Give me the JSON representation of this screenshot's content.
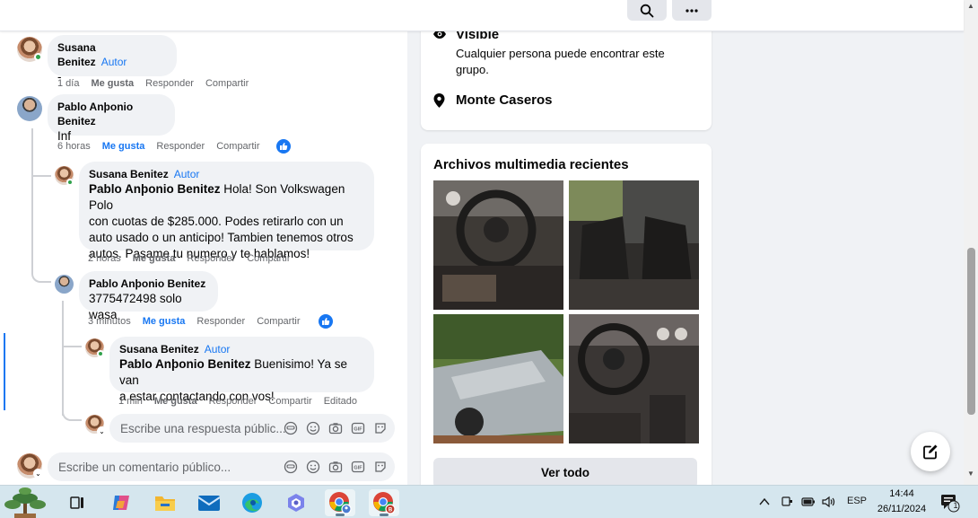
{
  "topbar": {
    "search_icon": "search-icon",
    "more_icon": "more-icon"
  },
  "comments": [
    {
      "author": "Susana Benitez",
      "badge": "Autor",
      "text": "-",
      "time": "1 día",
      "like": "Me gusta",
      "reply": "Responder",
      "share": "Compartir"
    },
    {
      "author": "Pablo Anþonio Benitez",
      "text": "Inf",
      "time": "6 horas",
      "like": "Me gusta",
      "reply": "Responder",
      "share": "Compartir"
    },
    {
      "author": "Susana Benitez",
      "badge": "Autor",
      "mention": "Pablo Anþonio Benitez",
      "text_l1": " Hola! Son Volkswagen Polo",
      "text_l2": "con cuotas de $285.000. Podes retirarlo con un",
      "text_l3": "auto usado o un anticipo! Tambien tenemos otros",
      "text_l4": "autos. Pasame tu numero y te hablamos!",
      "time": "2 horas",
      "like": "Me gusta",
      "reply": "Responder",
      "share": "Compartir"
    },
    {
      "author": "Pablo Anþonio Benitez",
      "text": "3775472498 solo wasa",
      "time": "3 minutos",
      "like": "Me gusta",
      "reply": "Responder",
      "share": "Compartir"
    },
    {
      "author": "Susana Benitez",
      "badge": "Autor",
      "mention": "Pablo Anþonio Benitez",
      "text_l1": " Buenisimo! Ya se van",
      "text_l2": "a estar contactando con vos!",
      "time": "1 min",
      "like": "Me gusta",
      "reply": "Responder",
      "share": "Compartir",
      "edited": "Editado"
    }
  ],
  "reply_input": {
    "placeholder": "Escribe una respuesta públic..."
  },
  "comment_input": {
    "placeholder": "Escribe un comentario público..."
  },
  "about": {
    "visible_title": "Visible",
    "visible_desc_l1": "Cualquier persona puede encontrar este",
    "visible_desc_l2": "grupo.",
    "location": "Monte Caseros"
  },
  "media": {
    "title": "Archivos multimedia recientes",
    "see_all": "Ver todo"
  },
  "taskbar": {
    "apps": [
      "widgets-icon",
      "start-icon",
      "task-view-icon",
      "copilot-icon",
      "file-explorer-icon",
      "mail-icon",
      "edge-icon",
      "teams-icon",
      "chrome-profile-icon",
      "chrome-icon"
    ],
    "lang": "ESP",
    "time": "14:44",
    "date": "26/11/2024",
    "notifications": "1"
  },
  "colors": {
    "accent": "#1877f2",
    "bubble": "#f0f2f5",
    "muted": "#65676b",
    "online": "#31a24c"
  }
}
